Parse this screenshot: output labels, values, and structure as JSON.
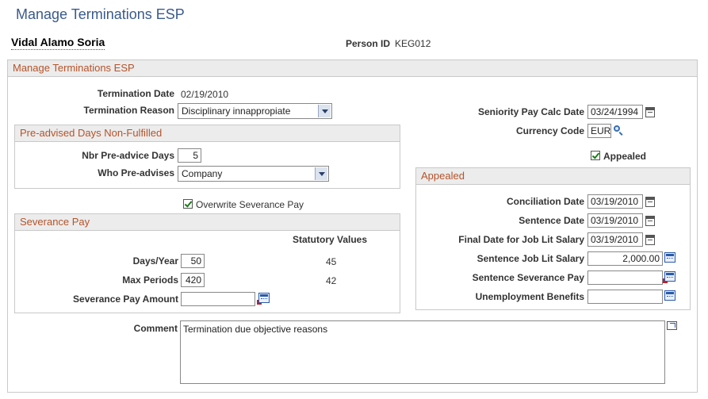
{
  "page": {
    "title": "Manage Terminations ESP"
  },
  "person": {
    "name": "Vidal Alamo Soria",
    "id_label": "Person ID",
    "id_value": "KEG012"
  },
  "main_group": {
    "title": "Manage Terminations ESP"
  },
  "termination": {
    "date_label": "Termination Date",
    "date_value": "02/19/2010",
    "reason_label": "Termination Reason",
    "reason_value": "Disciplinary innappropiate"
  },
  "seniority": {
    "label": "Seniority Pay Calc Date",
    "value": "03/24/1994"
  },
  "currency": {
    "label": "Currency Code",
    "value": "EUR"
  },
  "appealed_checkbox": {
    "label": "Appealed",
    "checked": true
  },
  "preadvised": {
    "title": "Pre-advised Days Non-Fulfilled",
    "nbr_label": "Nbr Pre-advice Days",
    "nbr_value": "5",
    "who_label": "Who Pre-advises",
    "who_value": "Company"
  },
  "overwrite": {
    "label": "Overwrite Severance Pay",
    "checked": true
  },
  "severance": {
    "title": "Severance Pay",
    "statutory_header": "Statutory Values",
    "days_label": "Days/Year",
    "days_value": "50",
    "days_statutory": "45",
    "max_label": "Max Periods",
    "max_value": "420",
    "max_statutory": "42",
    "amount_label": "Severance Pay Amount",
    "amount_value": ""
  },
  "appealed": {
    "title": "Appealed",
    "conciliation_label": "Conciliation Date",
    "conciliation_value": "03/19/2010",
    "sentence_label": "Sentence Date",
    "sentence_value": "03/19/2010",
    "final_label": "Final Date for Job Lit Salary",
    "final_value": "03/19/2010",
    "job_lit_label": "Sentence Job Lit Salary",
    "job_lit_value": "2,000.00",
    "sev_pay_label": "Sentence Severance Pay",
    "sev_pay_value": "",
    "unemp_label": "Unemployment Benefits",
    "unemp_value": ""
  },
  "comment": {
    "label": "Comment",
    "value": "Termination due objective reasons"
  },
  "colors": {
    "title": "#3a5a8c",
    "group_header_text": "#b5532a",
    "group_header_bg": "#ececec"
  }
}
